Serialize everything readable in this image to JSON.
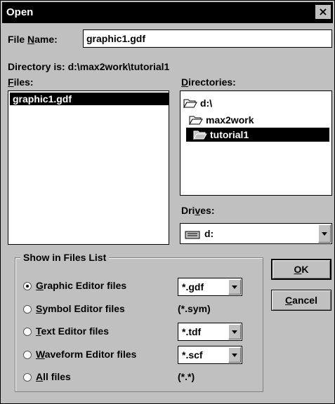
{
  "window": {
    "title": "Open",
    "close_glyph": "×"
  },
  "file_name": {
    "label_pre": "File ",
    "label_u": "N",
    "label_post": "ame:",
    "value": "graphic1.gdf"
  },
  "directory_is": "Directory is: d:\\max2work\\tutorial1",
  "files": {
    "label_u": "F",
    "label_post": "iles:",
    "items": [
      "graphic1.gdf"
    ]
  },
  "directories": {
    "label_u": "D",
    "label_post": "irectories:",
    "items": [
      {
        "name": "d:\\",
        "icon": "open-folder-icon",
        "selected": false
      },
      {
        "name": "max2work",
        "icon": "open-folder-icon",
        "selected": false
      },
      {
        "name": "tutorial1",
        "icon": "open-folder-icon",
        "selected": true
      }
    ]
  },
  "drives": {
    "label_pre": "Dri",
    "label_u": "v",
    "label_post": "es:",
    "value": "d:",
    "icon": "drive-icon"
  },
  "show_in_files_list": {
    "label": "Show in Files List",
    "options": [
      {
        "u": "G",
        "rest": "raphic Editor files",
        "filter": "*.gdf",
        "filter_type": "combo",
        "checked": true
      },
      {
        "u": "S",
        "rest": "ymbol Editor files",
        "filter": "(*.sym)",
        "filter_type": "text",
        "checked": false
      },
      {
        "u": "T",
        "rest": "ext Editor files",
        "filter": "*.tdf",
        "filter_type": "combo",
        "checked": false
      },
      {
        "u": "W",
        "rest": "aveform Editor files",
        "filter": "*.scf",
        "filter_type": "combo",
        "checked": false
      },
      {
        "u": "A",
        "rest": "ll files",
        "filter": "(*.*)",
        "filter_type": "text",
        "checked": false
      }
    ]
  },
  "buttons": {
    "ok": {
      "u": "O",
      "rest": "K"
    },
    "cancel": {
      "u": "C",
      "rest": "ancel"
    }
  }
}
